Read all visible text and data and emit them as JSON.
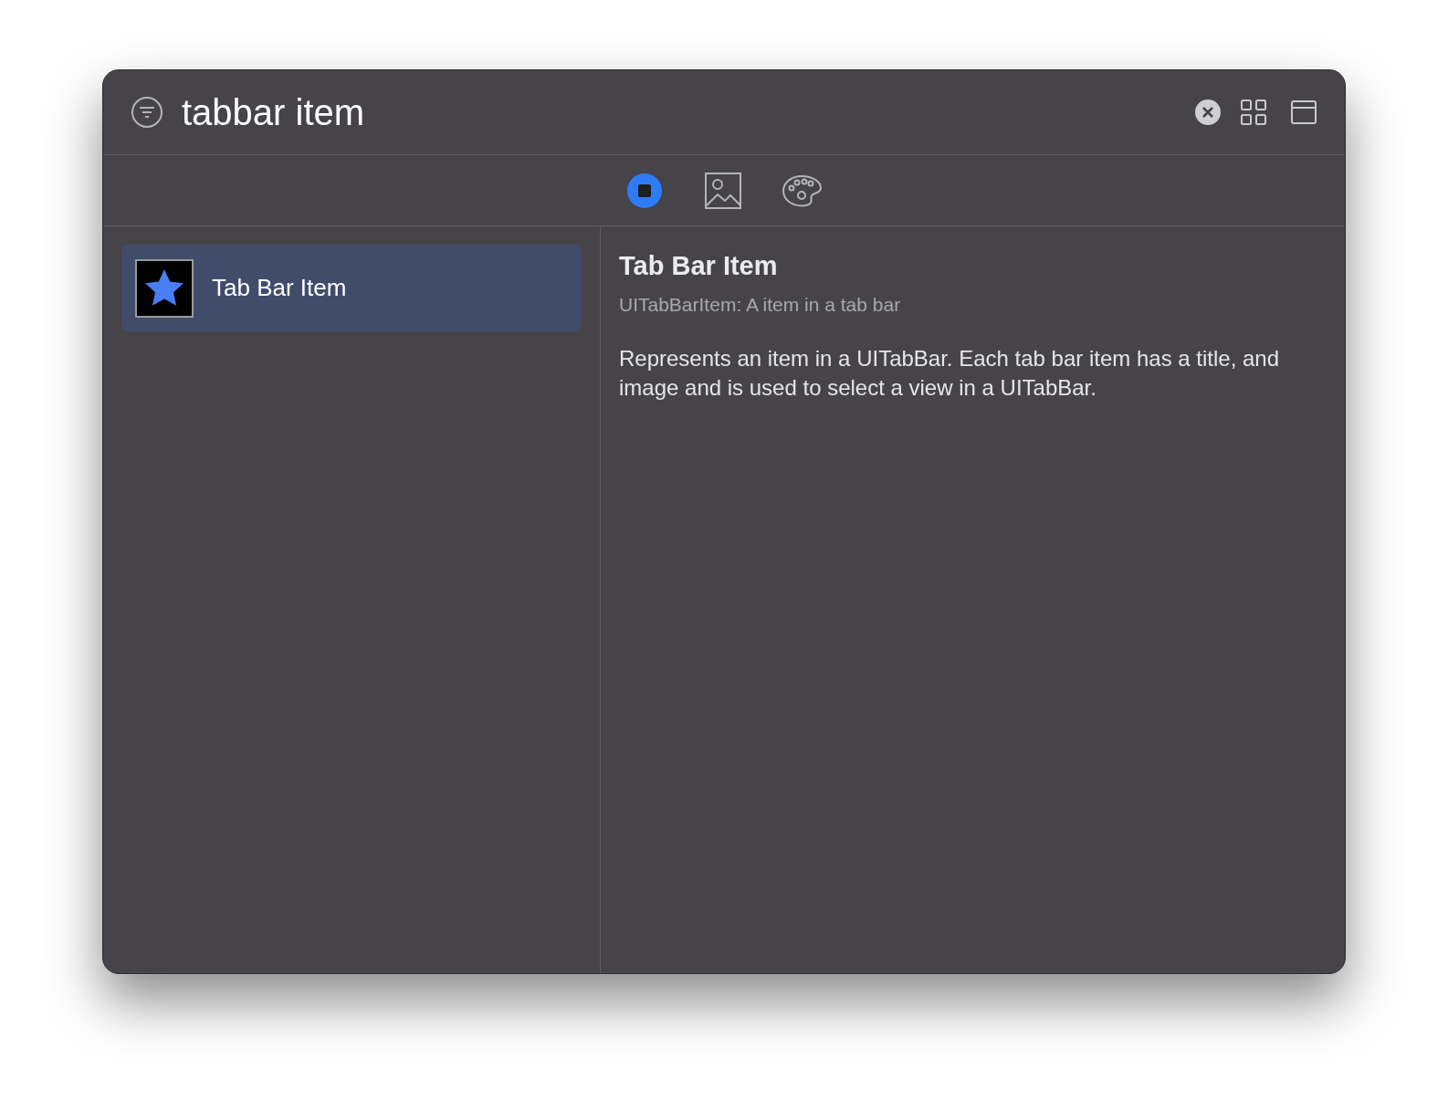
{
  "search": {
    "value": "tabbar item"
  },
  "library_tabs": [
    {
      "kind": "objects",
      "selected": true
    },
    {
      "kind": "media",
      "selected": false
    },
    {
      "kind": "colors",
      "selected": false
    }
  ],
  "results": [
    {
      "title": "Tab Bar Item",
      "selected": true
    }
  ],
  "detail": {
    "title": "Tab Bar Item",
    "subtitle": "UITabBarItem: A item in a tab bar",
    "description": "Represents an item in a UITabBar. Each tab bar item has a title, and image and is used to select a view in a UITabBar."
  }
}
